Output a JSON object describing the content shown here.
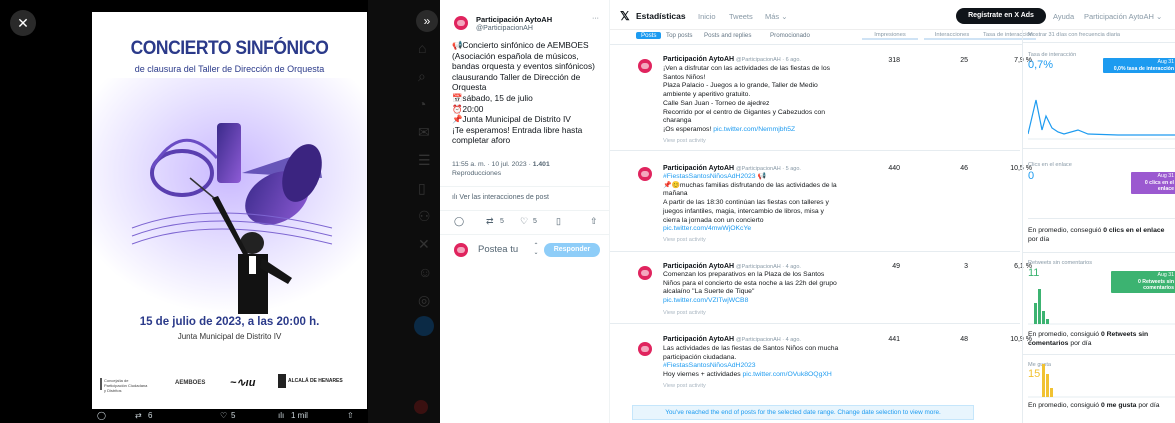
{
  "viewer": {
    "close_icon": "close-icon",
    "next_icon": "chevron-right-icon",
    "poster": {
      "title": "CONCIERTO SINFÓNICO",
      "subtitle": "de clausura del Taller de Dirección de Orquesta",
      "date_line": "15 de julio de 2023, a las 20:00 h.",
      "venue": "Junta Municipal de Distrito IV",
      "logo_aemboes": "AEMBOES",
      "logo_alcala": "ALCALÁ DE HENARES"
    },
    "actions": {
      "replies": "",
      "retweets": "6",
      "likes": "5",
      "views": "1 mil"
    }
  },
  "tweet": {
    "name": "Participación AytoAH",
    "handle": "@ParticipacionAH",
    "more": "···",
    "body_lines": [
      "📢Concierto sinfónico de AEMBOES",
      "(Asociación española de músicos,",
      "bandas orquesta y eventos sinfónicos)",
      "clausurando Taller de Dirección de",
      "Orquesta",
      "📅sábado, 15 de julio",
      "⏰20:00",
      "📌Junta Municipal de Distrito IV",
      "¡Te esperamos! Entrada libre hasta",
      "completar aforo"
    ],
    "meta_time": "11:55 a. m. · 10 jul. 2023 ·",
    "meta_views": "1.401",
    "meta_label": "Reproducciones",
    "interactions_link": "Ver las interacciones de post",
    "counts": {
      "retweets": "5",
      "likes": "5"
    },
    "reply_placeholder": "Postea tu",
    "reply_button": "Responder"
  },
  "analytics": {
    "brand": "Estadísticas",
    "nav": [
      "Inicio",
      "Tweets",
      "Más ⌄"
    ],
    "signup": "Regístrate en X Ads",
    "help": "Ayuda",
    "account": "Participación AytoAH ⌄",
    "subtabs": [
      "Posts",
      "Top posts",
      "Posts and replies",
      "Promocionado"
    ],
    "columns": [
      "Impresiones",
      "Interacciones",
      "Tasa de interacción"
    ],
    "rows": [
      {
        "name": "Participación AytoAH",
        "handle": "@ParticipacionAH · 6 ago.",
        "lines": [
          "¡Ven a disfrutar con las actividades de las fiestas de los",
          "Santos Niños!",
          "Plaza Palacio - Juegos a lo grande, Taller de Medio",
          "ambiente y aperitivo gratuito.",
          "Calle San Juan - Torneo de ajedrez",
          "Recorrido por el centro de Gigantes y Cabezudos con",
          "charanga",
          "¡Os esperamos!"
        ],
        "link": "pic.twitter.com/Nemmjbh5Z",
        "view": "View post activity",
        "impressions": "318",
        "interactions": "25",
        "rate": "7,9 %"
      },
      {
        "name": "Participación AytoAH",
        "handle": "@ParticipacionAH · 5 ago.",
        "hashtag": "#FiestasSantosNiñosAdH2023 📢",
        "lines": [
          "📌😊muchas familias disfrutando de las actividades de la",
          "mañana",
          "A partir de las 18:30 continúan las fiestas con talleres y",
          "juegos infantiles, magia, intercambio de libros, misa y",
          "cierra la jornada con un concierto"
        ],
        "link": "pic.twitter.com/4mwWjOKcYe",
        "view": "View post activity",
        "impressions": "440",
        "interactions": "46",
        "rate": "10,5 %"
      },
      {
        "name": "Participación AytoAH",
        "handle": "@ParticipacionAH · 4 ago.",
        "lines": [
          "Comenzan los preparativos en la Plaza de los Santos",
          "Niños para el concierto de esta noche a las 22h del grupo",
          "alcalaíno \"La Suerte de Tique\""
        ],
        "link": "pic.twitter.com/VZITwjWCB8",
        "view": "View post activity",
        "impressions": "49",
        "interactions": "3",
        "rate": "6,1 %"
      },
      {
        "name": "Participación AytoAH",
        "handle": "@ParticipacionAH · 4 ago.",
        "lines": [
          "Las actividades de las fiestas de Santos Niños con mucha",
          "participación ciudadana."
        ],
        "hashtag": "#FiestasSantosNiñosAdH2023",
        "tail": "Hoy viernes + actividades",
        "link": "pic.twitter.com/OVuk8OQgXH",
        "view": "View post activity",
        "impressions": "441",
        "interactions": "48",
        "rate": "10,9 %"
      }
    ],
    "end_banner": "You've reached the end of posts for the selected date range. Change date selection to view more.",
    "side": {
      "header": "Mostrar 31 días con frecuencia diaria",
      "rate_label": "Tasa de interacción",
      "rate_value": "0,7%",
      "rate_tag_date": "Aug 31",
      "rate_tag": "0,0% tasa de interacción",
      "clicks_label": "Clics en el enlace",
      "clicks_value": "0",
      "clicks_tag_date": "Aug 31",
      "clicks_tag": "0 clics en el enlace",
      "clicks_avg_pre": "En promedio, conseguió",
      "clicks_avg_bold": "0 clics en el enlace",
      "clicks_avg_post": "por día",
      "rt_label": "Retweets sin comentarios",
      "rt_value": "11",
      "rt_tag_date": "Aug 31",
      "rt_tag": "0 Retweets sin comentarios",
      "rt_avg_pre": "En promedio, consiguió",
      "rt_avg_bold": "0 Retweets sin comentarios",
      "rt_avg_post": "por día",
      "likes_label": "Me gusta",
      "likes_value": "15",
      "likes_avg_pre": "En promedio, consiguió",
      "likes_avg_bold": "0 me gusta",
      "likes_avg_post": "por día",
      "colors": {
        "blue": "#1d9bf0",
        "purple": "#9b59d0",
        "green": "#3cb371",
        "yellow": "#f1c232"
      }
    }
  }
}
